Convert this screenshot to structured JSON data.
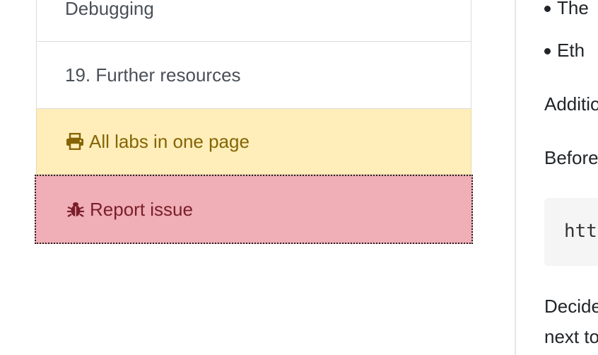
{
  "sidebar": {
    "items": [
      {
        "label": "Debugging"
      },
      {
        "label": "19. Further resources"
      },
      {
        "label": "All labs in one page",
        "icon": "print-icon"
      },
      {
        "label": "Report issue",
        "icon": "bug-icon"
      }
    ],
    "colors": {
      "labs_bg": "#ffeeba",
      "labs_text": "#856404",
      "report_bg": "#f0aeb6",
      "report_text": "#7a1f2a"
    }
  },
  "content": {
    "bullets": [
      "The",
      "Eth"
    ],
    "paragraphs": [
      "Additio",
      "Before",
      "Decide",
      "next to"
    ],
    "code": "htt"
  }
}
